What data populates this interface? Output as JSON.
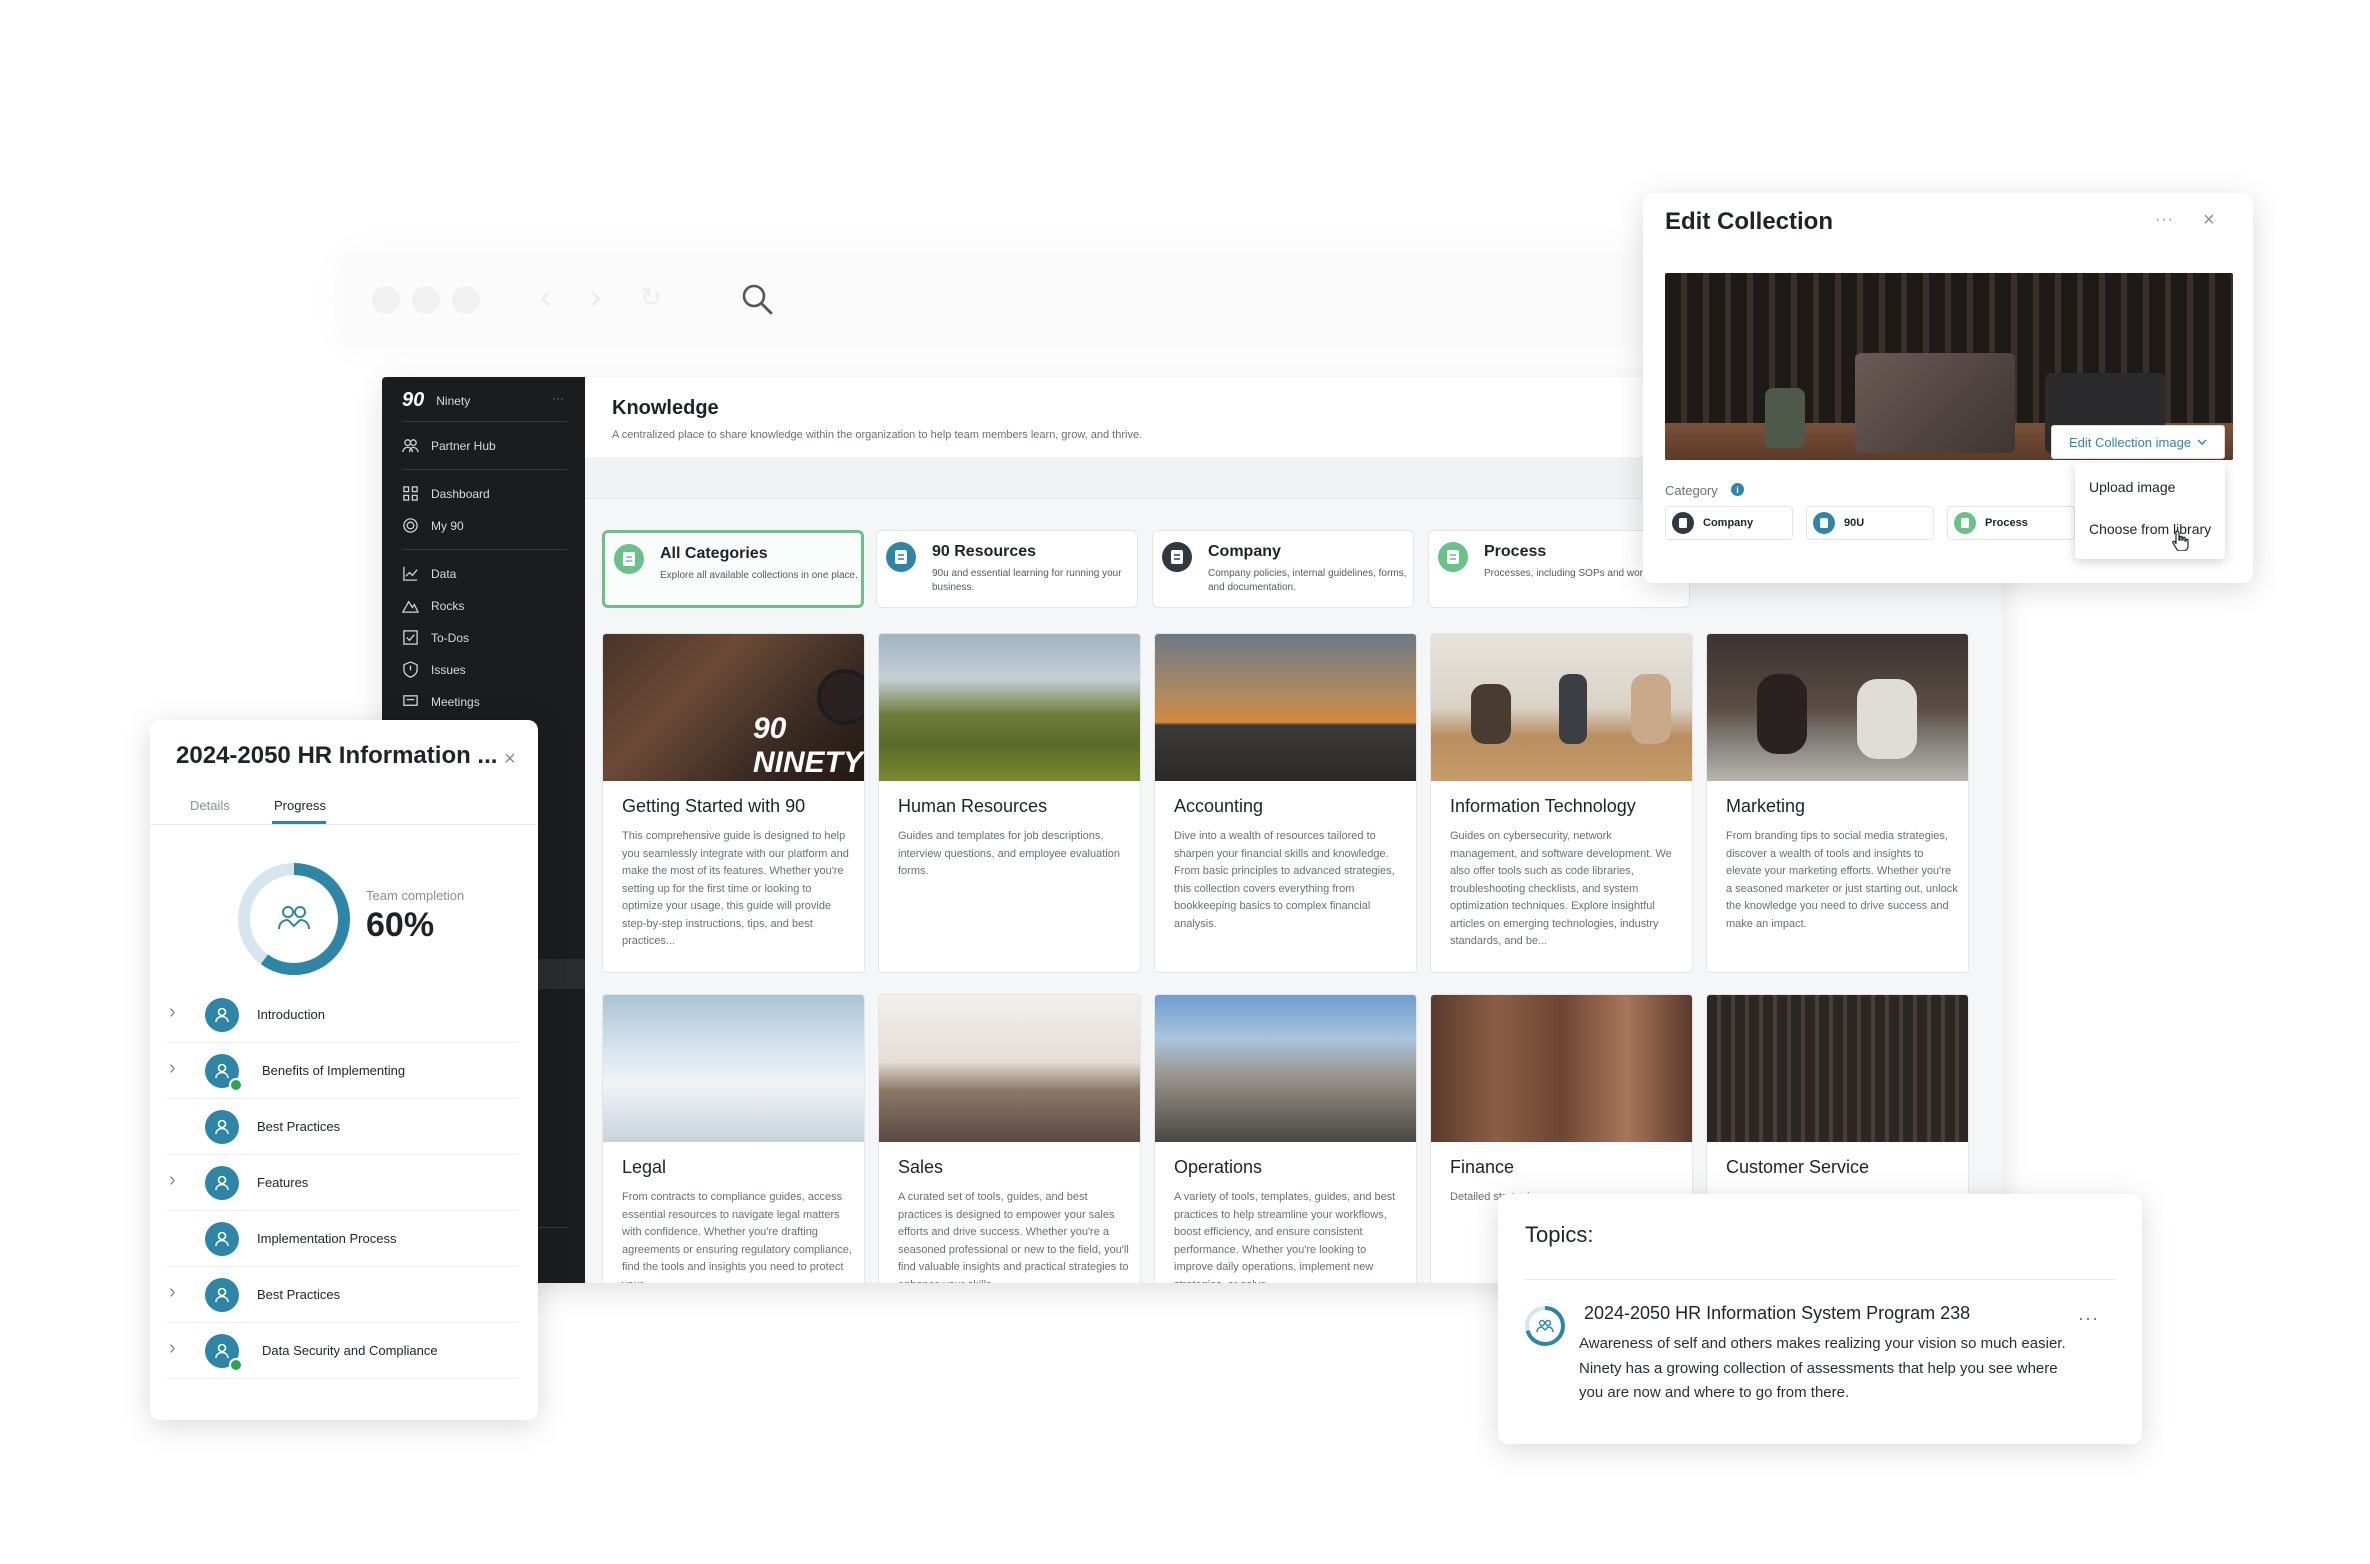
{
  "sidebar": {
    "brand": "Ninety",
    "more": "···",
    "items": [
      {
        "label": "Partner Hub",
        "icon": "users-icon"
      },
      {
        "label": "Dashboard",
        "icon": "grid-icon"
      },
      {
        "label": "My 90",
        "icon": "target-icon"
      },
      {
        "label": "Data",
        "icon": "chart-line-icon"
      },
      {
        "label": "Rocks",
        "icon": "mountain-icon"
      },
      {
        "label": "To-Dos",
        "icon": "checkbox-icon"
      },
      {
        "label": "Issues",
        "icon": "shield-icon"
      },
      {
        "label": "Meetings",
        "icon": "meeting-icon"
      }
    ]
  },
  "header": {
    "title": "Knowledge",
    "subtitle": "A centralized place to share knowledge within the organization to help team members learn, grow, and thrive."
  },
  "categories": [
    {
      "name": "All Categories",
      "desc": "Explore all available collections in one place.",
      "color": "#6cc089"
    },
    {
      "name": "90 Resources",
      "desc": "90u and essential learning for running your business.",
      "color": "#2d86a6"
    },
    {
      "name": "Company",
      "desc": "Company policies, internal guidelines, forms, and documentation.",
      "color": "#2f3a40"
    },
    {
      "name": "Process",
      "desc": "Processes, including SOPs and workflows.",
      "color": "#6cc089"
    }
  ],
  "collections": [
    {
      "title": "Getting Started with 90",
      "desc": "This comprehensive guide is designed to help you seamlessly integrate with our platform and make the most of its features. Whether you're setting up for the first time or looking to optimize your usage, this guide will provide step-by-step instructions, tips, and best practices...",
      "image_label": "90 NINETY"
    },
    {
      "title": "Human Resources",
      "desc": "Guides and templates for job descriptions, interview questions, and employee evaluation forms."
    },
    {
      "title": "Accounting",
      "desc": "Dive into a wealth of resources tailored to sharpen your financial skills and knowledge. From basic principles to advanced strategies, this collection covers everything from bookkeeping basics to complex financial analysis."
    },
    {
      "title": "Information Technology",
      "desc": "Guides on cybersecurity, network management, and software development. We also offer tools such as code libraries, troubleshooting checklists, and system optimization techniques. Explore insightful articles on emerging technologies, industry standards, and be..."
    },
    {
      "title": "Marketing",
      "desc": "From branding tips to social media strategies, discover a wealth of tools and insights to elevate your marketing efforts. Whether you're a seasoned marketer or just starting out, unlock the knowledge you need to drive success and make an impact."
    },
    {
      "title": "Legal",
      "desc": "From contracts to compliance guides, access essential resources to navigate legal matters with confidence. Whether you're drafting agreements or ensuring regulatory compliance, find the tools and insights you need to protect your..."
    },
    {
      "title": "Sales",
      "desc": "A curated set of tools, guides, and best practices is designed to empower your sales efforts and drive success. Whether you're a seasoned professional or new to the field, you'll find valuable insights and practical strategies to enhance your skills..."
    },
    {
      "title": "Operations",
      "desc": "A variety of tools, templates, guides, and best practices to help streamline your workflows, boost efficiency, and ensure consistent performance. Whether you're looking to improve daily operations, implement new strategies, or solve..."
    },
    {
      "title": "Finance",
      "desc": "Detailed strategies"
    },
    {
      "title": "Customer Service",
      "desc": ""
    }
  ],
  "hr_panel": {
    "title": "2024-2050 HR Information ...",
    "close": "×",
    "tabs": [
      "Details",
      "Progress"
    ],
    "completion_label": "Team completion",
    "completion_value": "60%",
    "completion_fraction": 0.6,
    "topics": [
      {
        "label": "Introduction",
        "expandable": true,
        "completed": false
      },
      {
        "label": "Benefits of Implementing",
        "expandable": true,
        "completed": true
      },
      {
        "label": "Best Practices",
        "expandable": false,
        "completed": false
      },
      {
        "label": "Features",
        "expandable": true,
        "completed": false
      },
      {
        "label": "Implementation Process",
        "expandable": false,
        "completed": false
      },
      {
        "label": "Best Practices",
        "expandable": true,
        "completed": false
      },
      {
        "label": "Data Security and Compliance",
        "expandable": true,
        "completed": true
      }
    ]
  },
  "edit_panel": {
    "title": "Edit Collection",
    "more": "···",
    "close": "×",
    "image_button": "Edit Collection image",
    "category_label": "Category",
    "info_glyph": "i",
    "chips": [
      {
        "label": "Company",
        "color": "#2f3a40"
      },
      {
        "label": "90U",
        "color": "#2d86a6"
      },
      {
        "label": "Process",
        "color": "#6cc089"
      }
    ],
    "menu": [
      "Upload image",
      "Choose from library"
    ]
  },
  "topics_panel": {
    "title": "Topics:",
    "item_title": "2024-2050 HR Information System Program 238",
    "item_desc": "Awareness of self and others makes realizing your vision so much easier. Ninety has a growing collection of assessments that help you see where you are now and where to go from there.",
    "more": "···"
  },
  "colors": {
    "accent": "#2d86a6",
    "success": "#6cc089",
    "sidebar_bg": "#1b1c1e"
  }
}
